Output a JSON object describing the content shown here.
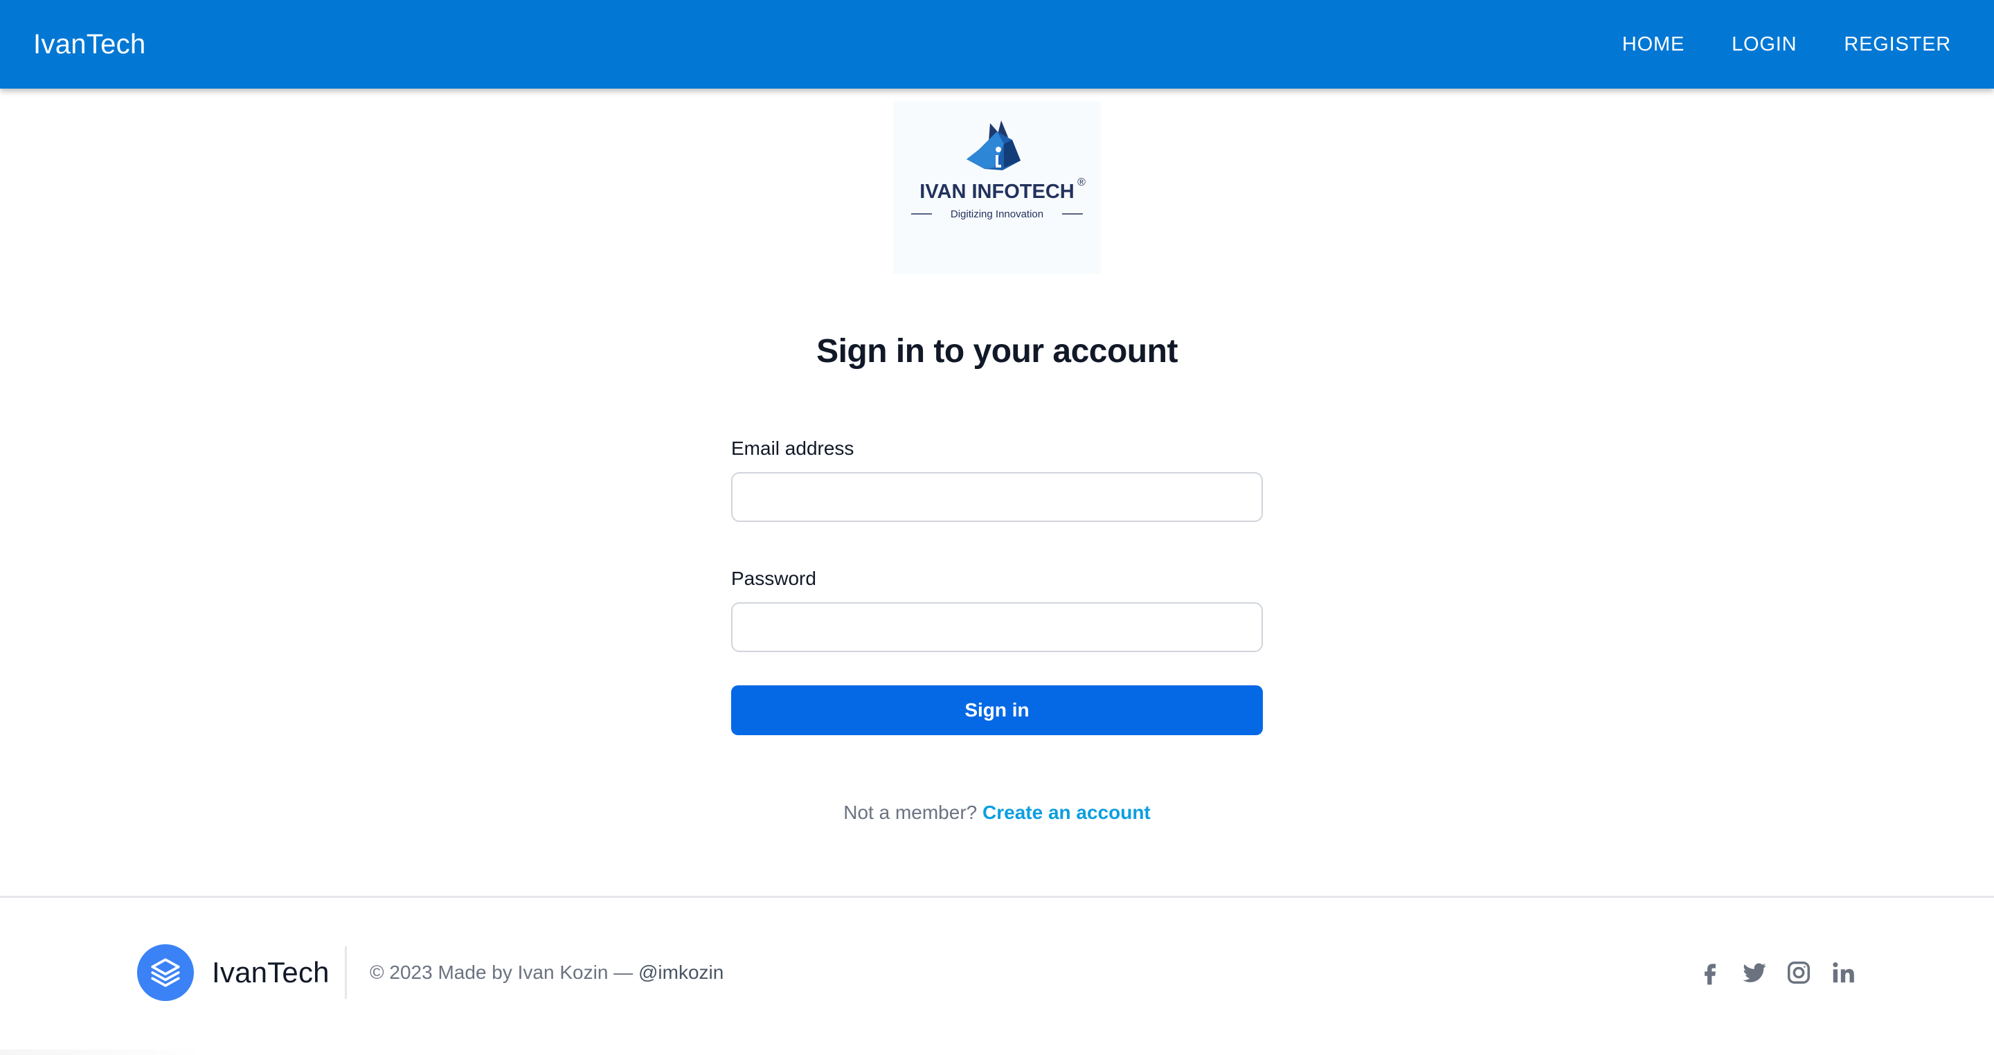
{
  "navbar": {
    "brand": "IvanTech",
    "links": [
      {
        "label": "HOME"
      },
      {
        "label": "LOGIN"
      },
      {
        "label": "REGISTER"
      }
    ]
  },
  "logo": {
    "name": "IVAN INFOTECH",
    "registered": "®",
    "tagline": "Digitizing Innovation"
  },
  "signin": {
    "title": "Sign in to your account",
    "email_label": "Email address",
    "email_value": "",
    "password_label": "Password",
    "password_value": "",
    "submit_label": "Sign in",
    "member_prompt": "Not a member?",
    "create_account_link": "Create an account"
  },
  "footer": {
    "brand": "IvanTech",
    "copyright": "© 2023 Made by Ivan Kozin —",
    "handle": "@imkozin",
    "social_icons": [
      "facebook-icon",
      "twitter-icon",
      "instagram-icon",
      "linkedin-icon"
    ]
  },
  "colors": {
    "appbar": "#0277d4",
    "primary_button": "#0569e6",
    "link": "#0c9ee0",
    "footer_logo": "#3b82f6",
    "social_icon": "#6b7280"
  }
}
